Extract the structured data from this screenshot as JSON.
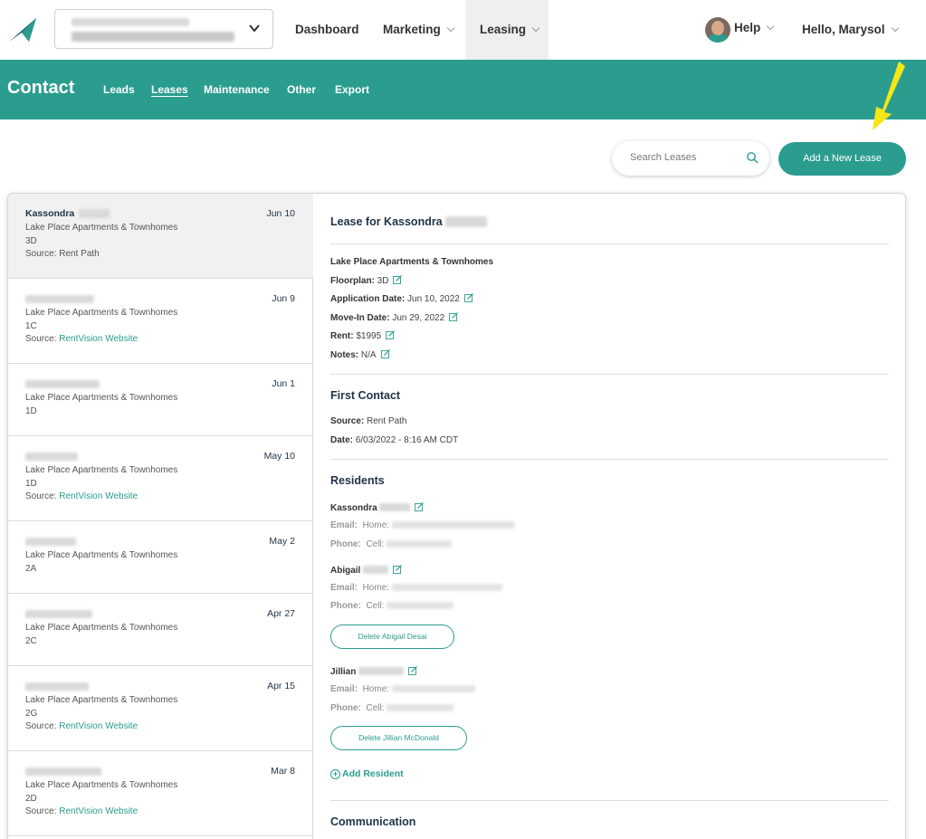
{
  "topnav": {
    "items": [
      {
        "label": "Dashboard"
      },
      {
        "label": "Marketing"
      },
      {
        "label": "Leasing"
      }
    ],
    "help_label": "Help",
    "greeting": "Hello, Marysol"
  },
  "subheader": {
    "title": "Contact",
    "tabs": [
      {
        "label": "Leads"
      },
      {
        "label": "Leases"
      },
      {
        "label": "Maintenance"
      },
      {
        "label": "Other"
      },
      {
        "label": "Export"
      }
    ]
  },
  "search": {
    "placeholder": "Search Leases"
  },
  "add_lease_label": "Add a New Lease",
  "leases": [
    {
      "name": "Kassondra",
      "date": "Jun 10",
      "property": "Lake Place Apartments & Townhomes",
      "unit": "3D",
      "source_label": "Source:",
      "source": "Rent Path"
    },
    {
      "name": "",
      "date": "Jun 9",
      "property": "Lake Place Apartments & Townhomes",
      "unit": "1C",
      "source_label": "Source:",
      "source": "RentVision Website"
    },
    {
      "name": "",
      "date": "Jun 1",
      "property": "Lake Place Apartments & Townhomes",
      "unit": "1D",
      "source_label": "",
      "source": ""
    },
    {
      "name": "",
      "date": "May 10",
      "property": "Lake Place Apartments & Townhomes",
      "unit": "1D",
      "source_label": "Source:",
      "source": "RentVision Website"
    },
    {
      "name": "",
      "date": "May 2",
      "property": "Lake Place Apartments & Townhomes",
      "unit": "2A",
      "source_label": "",
      "source": ""
    },
    {
      "name": "",
      "date": "Apr 27",
      "property": "Lake Place Apartments & Townhomes",
      "unit": "2C",
      "source_label": "",
      "source": ""
    },
    {
      "name": "",
      "date": "Apr 15",
      "property": "Lake Place Apartments & Townhomes",
      "unit": "2G",
      "source_label": "Source:",
      "source": "RentVision Website"
    },
    {
      "name": "",
      "date": "Mar 8",
      "property": "Lake Place Apartments & Townhomes",
      "unit": "2D",
      "source_label": "Source:",
      "source": "RentVision Website"
    }
  ],
  "detail": {
    "title": "Lease for Kassondra",
    "property": "Lake Place Apartments & Townhomes",
    "floorplan_label": "Floorplan:",
    "floorplan": "3D",
    "application_label": "Application Date:",
    "application_date": "Jun 10, 2022",
    "movein_label": "Move-In Date:",
    "movein_date": "Jun 29, 2022",
    "rent_label": "Rent:",
    "rent": "$1995",
    "notes_label": "Notes:",
    "notes": "N/A",
    "first_contact_heading": "First Contact",
    "source_label": "Source:",
    "source": "Rent Path",
    "date_label": "Date:",
    "date": "6/03/2022 - 8:16 AM CDT",
    "residents_heading": "Residents",
    "residents": [
      {
        "name": "Kassondra",
        "email_label": "Email:",
        "email_type": "Home:",
        "phone_label": "Phone:",
        "phone_type": "Cell:",
        "delete_label": ""
      },
      {
        "name": "Abigail",
        "email_label": "Email:",
        "email_type": "Home:",
        "phone_label": "Phone:",
        "phone_type": "Cell:",
        "delete_label": "Delete Abigail Desai"
      },
      {
        "name": "Jillian",
        "email_label": "Email:",
        "email_type": "Home:",
        "phone_label": "Phone:",
        "phone_type": "Cell:",
        "delete_label": "Delete Jillian McDonald"
      }
    ],
    "add_resident_label": "Add Resident",
    "communication_heading": "Communication"
  },
  "colors": {
    "accent": "#2a9d8f",
    "heading": "#1f3347",
    "annotation_arrow": "#f5e615"
  }
}
